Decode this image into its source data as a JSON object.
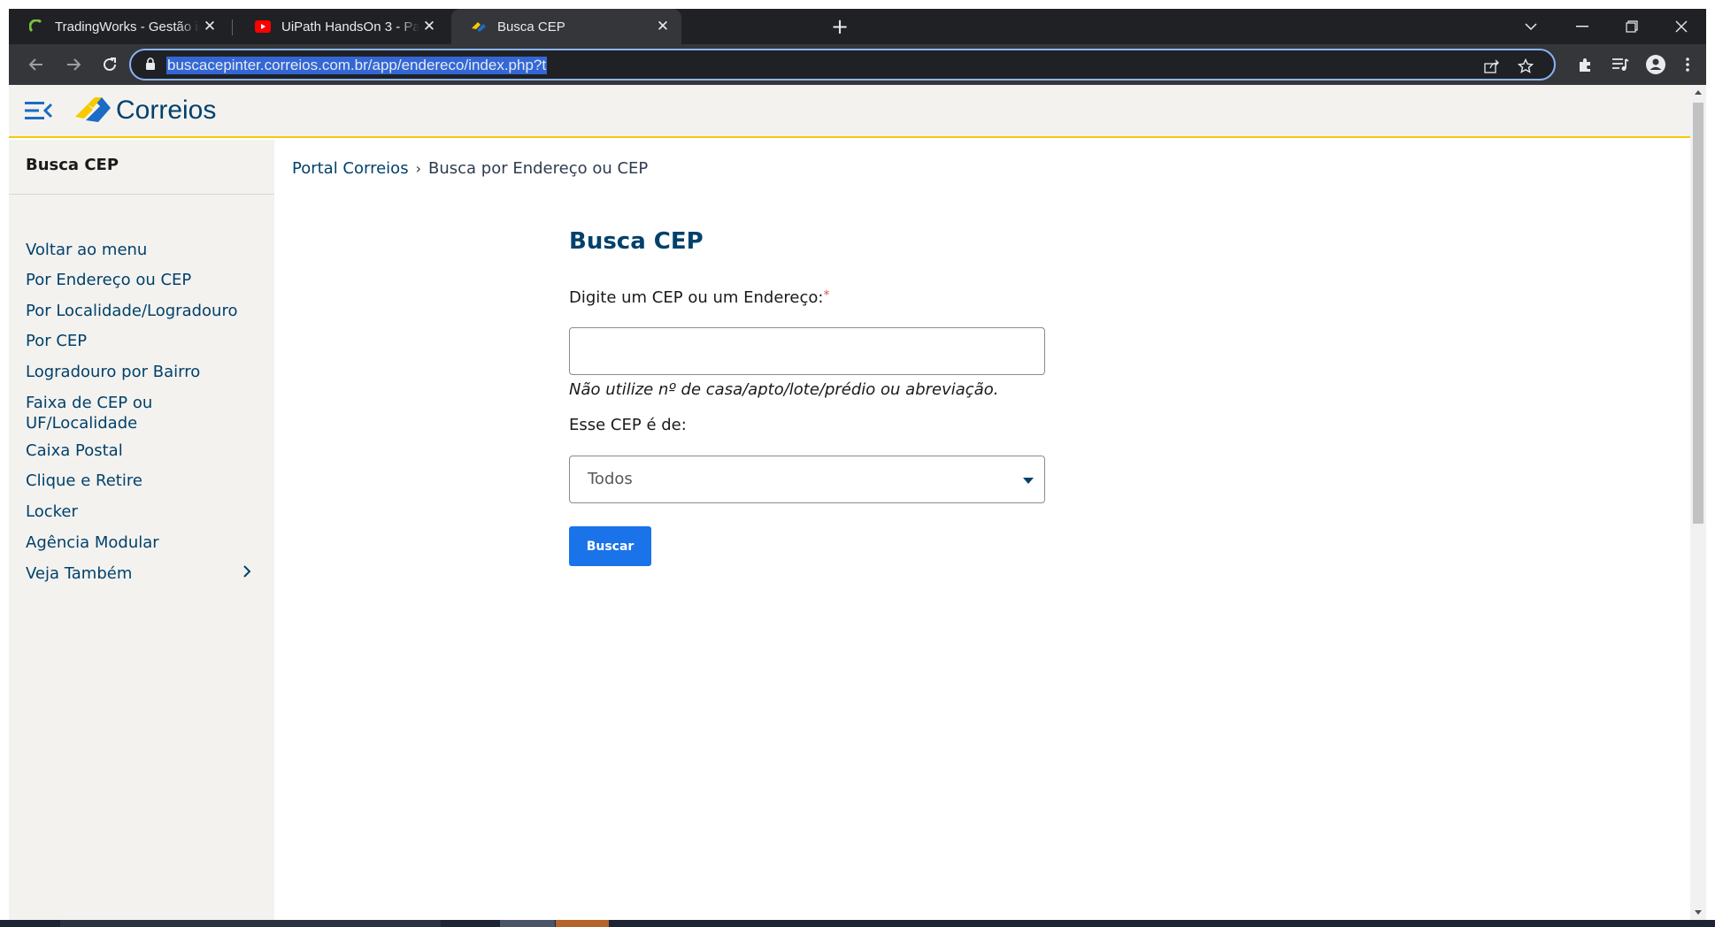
{
  "browser": {
    "tabs": [
      {
        "title": "TradingWorks - Gestão inteligente",
        "favicon": "tradingworks-icon",
        "active": false
      },
      {
        "title": "UiPath HandsOn 3 - Parte 9/13 - ",
        "favicon": "youtube-icon",
        "active": false
      },
      {
        "title": "Busca CEP",
        "favicon": "correios-icon",
        "active": true
      }
    ],
    "address": "buscacepinter.correios.com.br/app/endereco/index.php?t",
    "accent": "#8ab4f8"
  },
  "site": {
    "logo_text": "Correios",
    "brand_color": "#00416b",
    "accent_yellow": "#f9c900"
  },
  "sidebar": {
    "title": "Busca CEP",
    "items": [
      {
        "label": "Voltar ao menu"
      },
      {
        "label": "Por Endereço ou CEP"
      },
      {
        "label": "Por Localidade/Logradouro"
      },
      {
        "label": "Por CEP"
      },
      {
        "label": "Logradouro por Bairro"
      },
      {
        "label": "Faixa de CEP ou UF/Localidade"
      },
      {
        "label": "Caixa Postal"
      },
      {
        "label": "Clique e Retire"
      },
      {
        "label": "Locker"
      },
      {
        "label": "Agência Modular"
      },
      {
        "label": "Veja Também"
      }
    ]
  },
  "breadcrumb": {
    "home": "Portal Correios",
    "separator": "›",
    "current": "Busca por Endereço ou CEP"
  },
  "form": {
    "title": "Busca CEP",
    "cep_label": "Digite um CEP ou um Endereço:",
    "required_mark": "*",
    "cep_value": "",
    "hint": "Não utilize nº de casa/apto/lote/prédio ou abreviação.",
    "type_label": "Esse CEP é de:",
    "type_selected": "Todos",
    "submit_label": "Buscar",
    "button_color": "#1a73e8"
  }
}
